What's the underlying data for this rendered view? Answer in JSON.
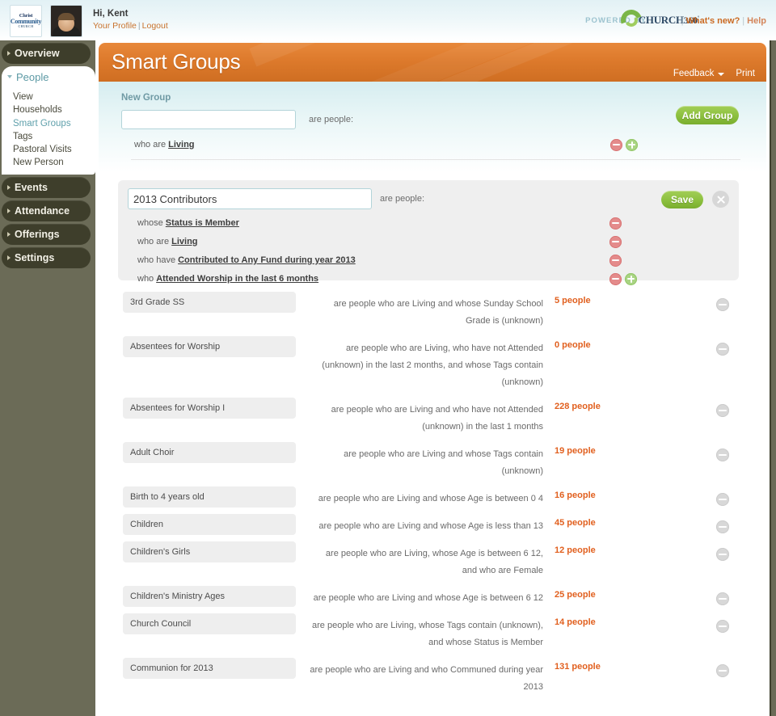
{
  "header": {
    "logo_lines": [
      "Christ",
      "Community",
      "CHURCH"
    ],
    "avatar_alt": "user-photo",
    "greeting": "Hi, Kent",
    "profile_link": "Your Profile",
    "separator": "|",
    "logout_link": "Logout",
    "powered_by": "POWERED BY",
    "brand_name": "CHURCH",
    "brand_num": "360",
    "brand_sup": "°",
    "whats_new": "What's new?",
    "help": "Help",
    "pipe": "|"
  },
  "sidebar": {
    "items": [
      {
        "label": "Overview",
        "active": false
      },
      {
        "label": "People",
        "active": true
      },
      {
        "label": "Events",
        "active": false
      },
      {
        "label": "Attendance",
        "active": false
      },
      {
        "label": "Offerings",
        "active": false
      },
      {
        "label": "Settings",
        "active": false
      }
    ],
    "subitems": [
      {
        "label": "View",
        "current": false
      },
      {
        "label": "Households",
        "current": false
      },
      {
        "label": "Smart Groups",
        "current": true
      },
      {
        "label": "Tags",
        "current": false
      },
      {
        "label": "Pastoral Visits",
        "current": false
      },
      {
        "label": "New Person",
        "current": false
      }
    ]
  },
  "page": {
    "title": "Smart Groups",
    "feedback": "Feedback",
    "print": "Print"
  },
  "new_group": {
    "heading": "New Group",
    "name_value": "",
    "name_placeholder": "",
    "are_people": "are people:",
    "add_button": "Add Group",
    "criteria": [
      {
        "prefix": "who are",
        "link": "Living"
      }
    ]
  },
  "edit_group": {
    "name_value": "2013 Contributors",
    "are_people": "are people:",
    "save_button": "Save",
    "close_label": "close-icon",
    "criteria": [
      {
        "prefix": "whose",
        "link": "Status is Member",
        "has_plus": false
      },
      {
        "prefix": "who are",
        "link": "Living",
        "has_plus": false
      },
      {
        "prefix": "who have",
        "link": "Contributed to Any Fund during year 2013",
        "has_plus": false
      },
      {
        "prefix": "who",
        "link": "Attended Worship in the  last 6 months",
        "has_plus": true
      }
    ]
  },
  "groups": [
    {
      "name": "3rd Grade SS",
      "description": "are people who are Living and whose Sunday School Grade is (unknown)",
      "count": "5 people"
    },
    {
      "name": "Absentees for Worship",
      "description": "are people who are Living, who have not Attended (unknown) in the last 2 months, and whose Tags contain (unknown)",
      "count": "0 people"
    },
    {
      "name": "Absentees for Worship I",
      "description": "are people who are Living and who have not Attended (unknown) in the last 1 months",
      "count": "228 people"
    },
    {
      "name": "Adult Choir",
      "description": "are people who are Living and whose Tags contain (unknown)",
      "count": "19 people"
    },
    {
      "name": "Birth to 4 years old",
      "description": "are people who are Living and whose Age is between 0 4",
      "count": "16 people"
    },
    {
      "name": "Children",
      "description": "are people who are Living and whose Age is less than 13",
      "count": "45 people"
    },
    {
      "name": "Children's Girls",
      "description": "are people who are Living, whose Age is between 6 12, and who are Female",
      "count": "12 people"
    },
    {
      "name": "Children's Ministry Ages",
      "description": "are people who are Living and whose Age is between 6 12",
      "count": "25 people"
    },
    {
      "name": "Church Council",
      "description": "are people who are Living, whose Tags contain (unknown), and whose Status is Member",
      "count": "14 people"
    },
    {
      "name": "Communion for 2013",
      "description": "are people who are Living and who Communed during year 2013",
      "count": "131 people"
    }
  ],
  "colors": {
    "accent_orange": "#dd7a2c",
    "count_orange": "#e1601f",
    "green_button": "#8cc03e",
    "sidebar_olive": "#6b6b57",
    "nav_dark": "#3e3e2b",
    "teal_link": "#5fa0ab",
    "panel_teal": "#d6edf0"
  }
}
